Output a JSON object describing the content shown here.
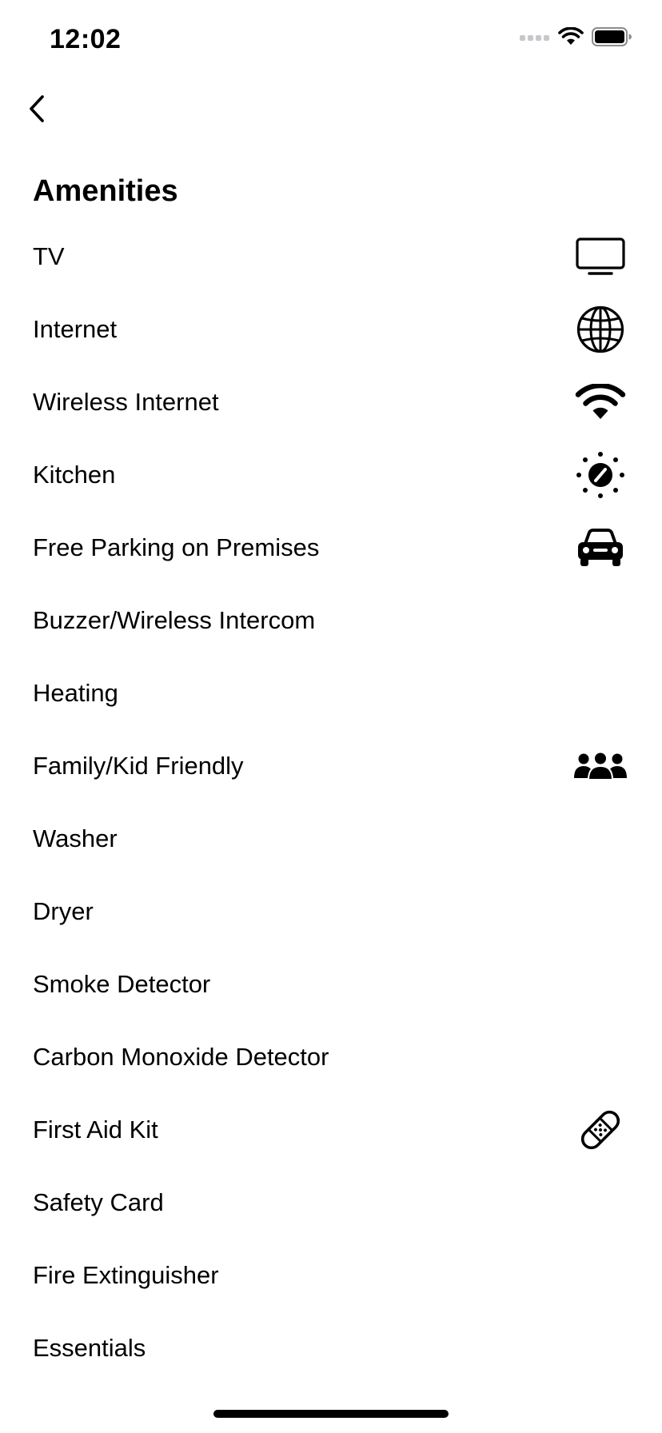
{
  "status_bar": {
    "time": "12:02",
    "signal_icon": "cellular-signal-icon",
    "wifi_icon": "wifi-icon",
    "battery_icon": "battery-icon"
  },
  "nav": {
    "back_icon": "chevron-left-icon"
  },
  "title": "Amenities",
  "amenities": [
    {
      "label": "TV",
      "icon": "tv-icon"
    },
    {
      "label": "Internet",
      "icon": "globe-icon"
    },
    {
      "label": "Wireless Internet",
      "icon": "wifi-icon"
    },
    {
      "label": "Kitchen",
      "icon": "stove-dial-icon"
    },
    {
      "label": "Free Parking on Premises",
      "icon": "car-icon"
    },
    {
      "label": "Buzzer/Wireless Intercom",
      "icon": ""
    },
    {
      "label": "Heating",
      "icon": ""
    },
    {
      "label": "Family/Kid Friendly",
      "icon": "people-group-icon"
    },
    {
      "label": "Washer",
      "icon": ""
    },
    {
      "label": "Dryer",
      "icon": ""
    },
    {
      "label": "Smoke Detector",
      "icon": ""
    },
    {
      "label": "Carbon Monoxide Detector",
      "icon": ""
    },
    {
      "label": "First Aid Kit",
      "icon": "bandage-icon"
    },
    {
      "label": "Safety Card",
      "icon": ""
    },
    {
      "label": "Fire Extinguisher",
      "icon": ""
    },
    {
      "label": "Essentials",
      "icon": ""
    }
  ],
  "colors": {
    "background": "#ffffff",
    "text": "#000000",
    "inactive_signal": "#c7c7cc"
  }
}
